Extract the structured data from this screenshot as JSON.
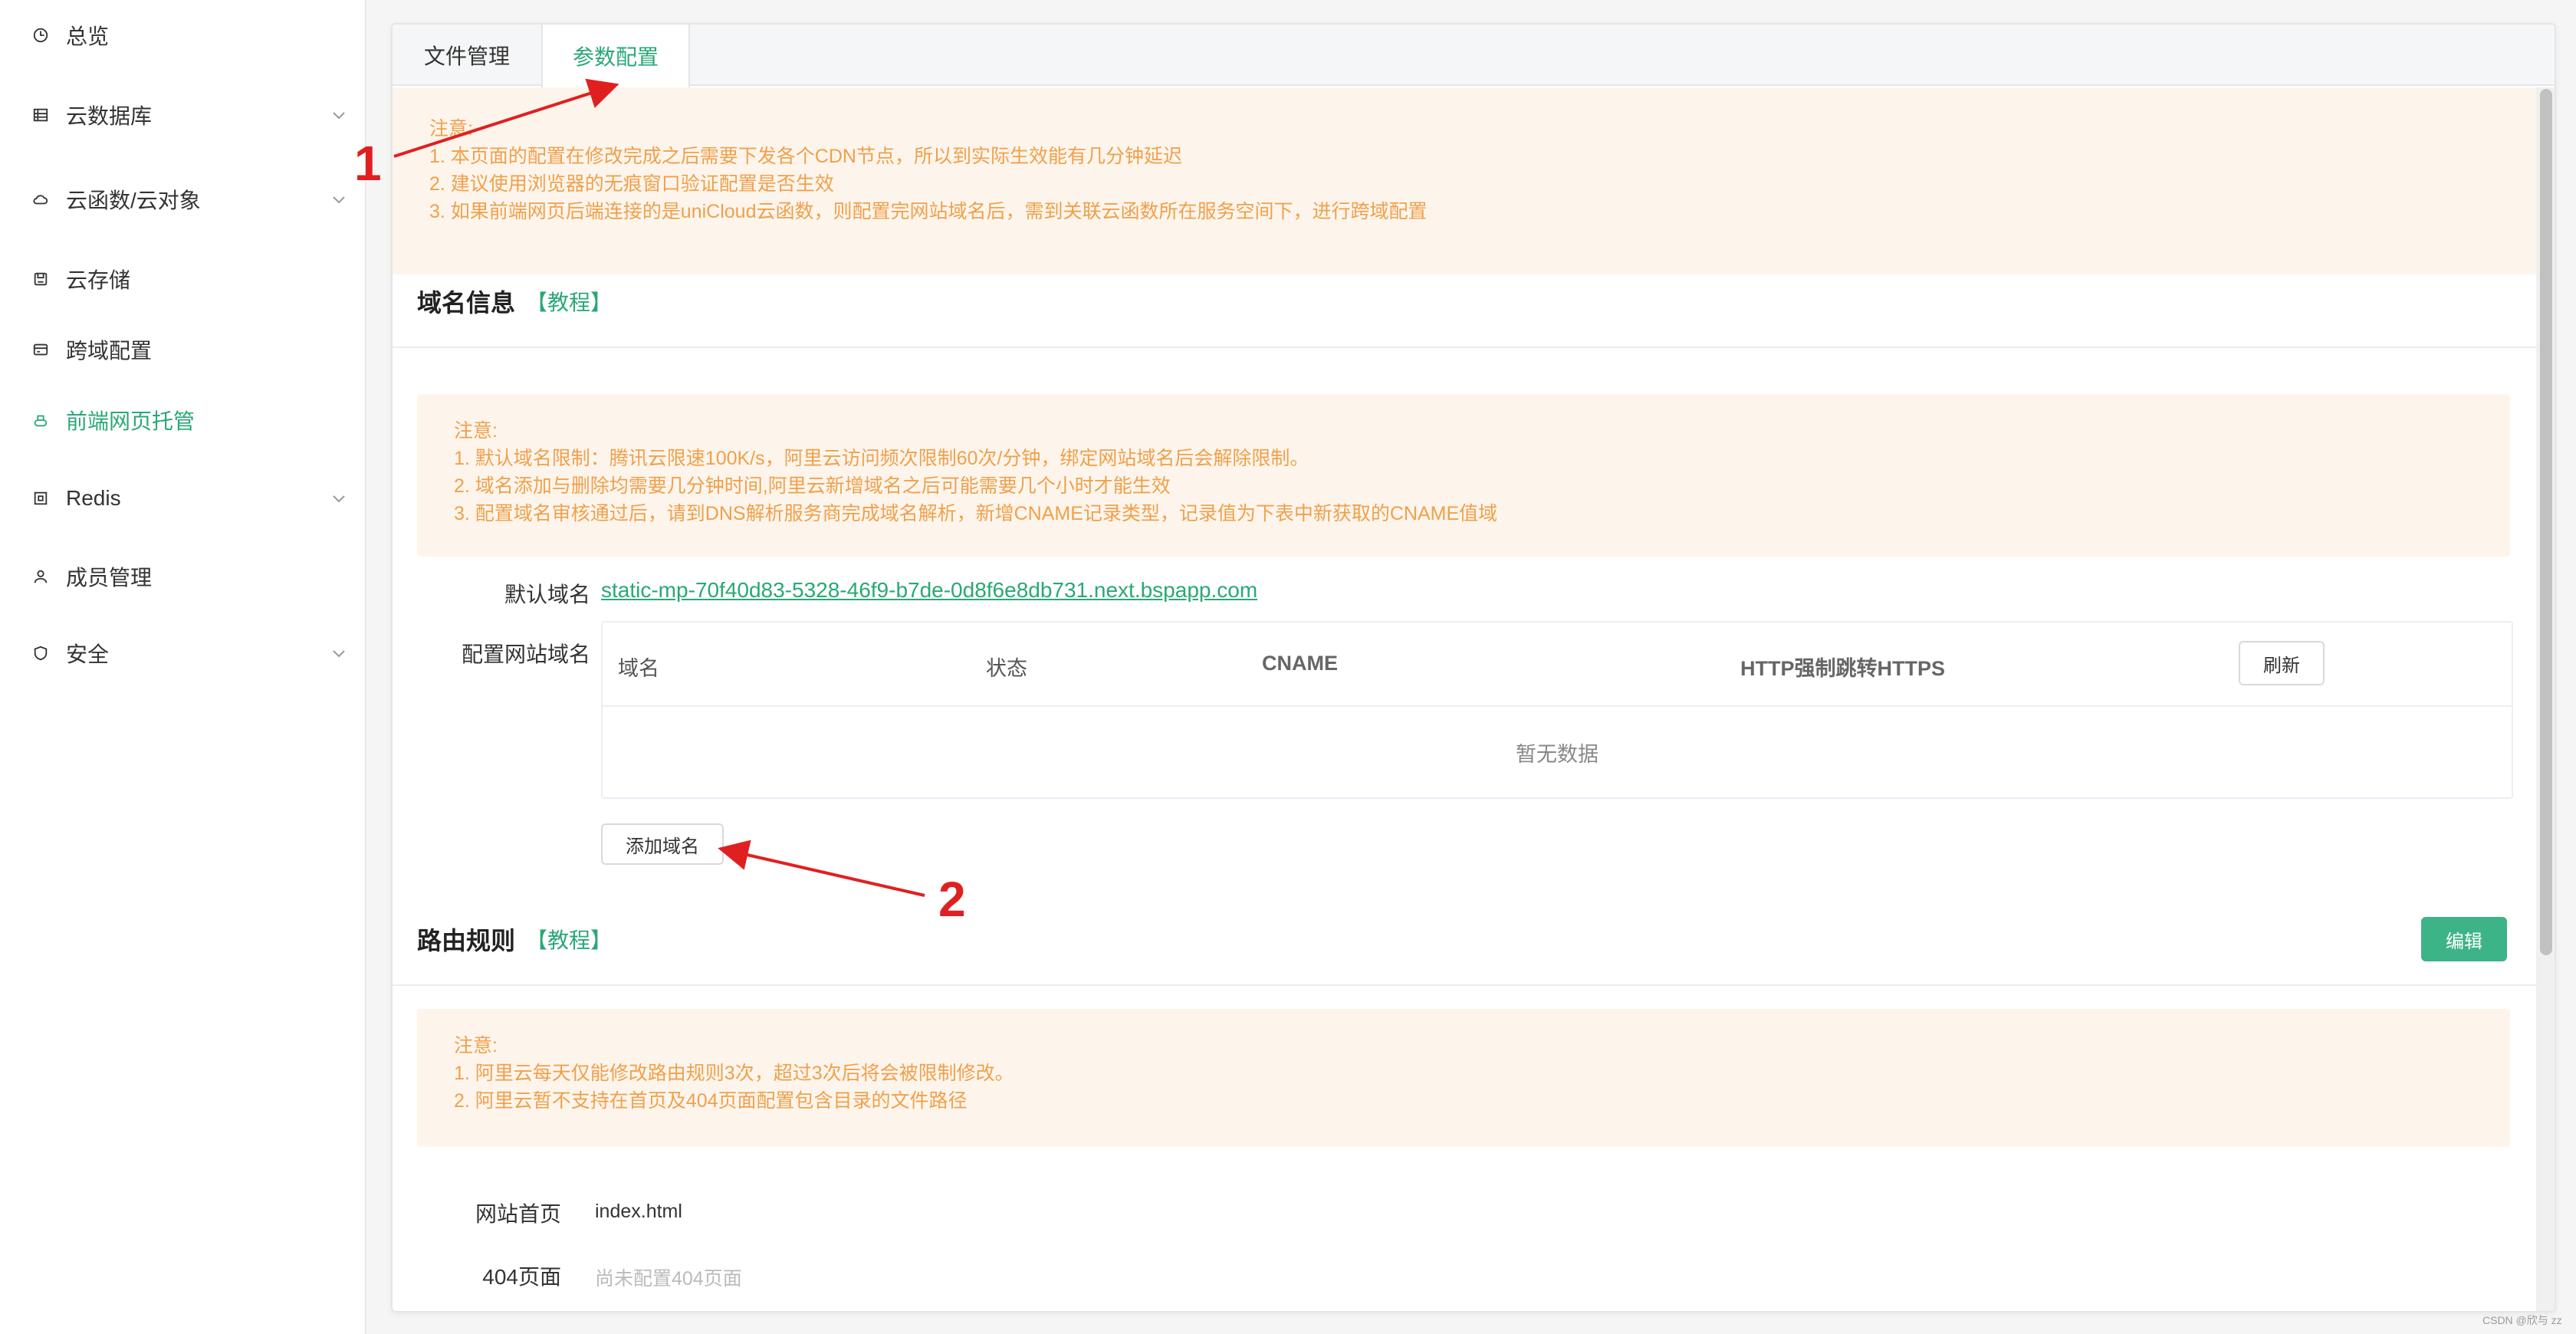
{
  "sidebar": {
    "items": [
      {
        "label": "总览",
        "icon": "clock-icon"
      },
      {
        "label": "云数据库",
        "icon": "database-icon",
        "expandable": true
      },
      {
        "label": "云函数/云对象",
        "icon": "cloud-icon",
        "expandable": true
      },
      {
        "label": "云存储",
        "icon": "storage-icon"
      },
      {
        "label": "跨域配置",
        "icon": "cors-icon"
      },
      {
        "label": "前端网页托管",
        "icon": "hosting-icon",
        "active": true
      },
      {
        "label": "Redis",
        "icon": "redis-icon",
        "expandable": true
      },
      {
        "label": "成员管理",
        "icon": "user-icon"
      },
      {
        "label": "安全",
        "icon": "shield-icon",
        "expandable": true
      }
    ]
  },
  "tabs": [
    {
      "label": "文件管理"
    },
    {
      "label": "参数配置",
      "active": true
    }
  ],
  "top_notice": {
    "title": "注意:",
    "lines": [
      "1. 本页面的配置在修改完成之后需要下发各个CDN节点，所以到实际生效能有几分钟延迟",
      "2. 建议使用浏览器的无痕窗口验证配置是否生效",
      "3. 如果前端网页后端连接的是uniCloud云函数，则配置完网站域名后，需到关联云函数所在服务空间下，进行跨域配置"
    ]
  },
  "domain_section": {
    "title": "域名信息",
    "tutorial": "【教程】",
    "notice_title": "注意:",
    "notice_lines": [
      "1. 默认域名限制：腾讯云限速100K/s，阿里云访问频次限制60次/分钟，绑定网站域名后会解除限制。",
      "2. 域名添加与删除均需要几分钟时间,阿里云新增域名之后可能需要几个小时才能生效",
      "3. 配置域名审核通过后，请到DNS解析服务商完成域名解析，新增CNAME记录类型，记录值为下表中新获取的CNAME值域"
    ],
    "default_domain_label": "默认域名",
    "default_domain": "static-mp-70f40d83-5328-46f9-b7de-0d8f6e8db731.next.bspapp.com",
    "custom_domain_label": "配置网站域名",
    "table": {
      "columns": [
        "域名",
        "状态",
        "CNAME",
        "HTTP强制跳转HTTPS"
      ],
      "refresh_label": "刷新",
      "empty_text": "暂无数据"
    },
    "add_label": "添加域名"
  },
  "route_section": {
    "title": "路由规则",
    "tutorial": "【教程】",
    "edit_label": "编辑",
    "notice_title": "注意:",
    "notice_lines": [
      "1. 阿里云每天仅能修改路由规则3次，超过3次后将会被限制修改。",
      "2. 阿里云暂不支持在首页及404页面配置包含目录的文件路径"
    ],
    "index_label": "网站首页",
    "index_value": "index.html",
    "notfound_label": "404页面",
    "notfound_value": "尚未配置404页面"
  },
  "annotations": {
    "marker1": "1",
    "marker2": "2",
    "color": "#e02020"
  },
  "watermark": "CSDN @欣与 zz",
  "colors": {
    "accent": "#2aa876",
    "notice_bg": "#fdf5ec",
    "notice_text": "#f0a04b",
    "edit_button": "#3db388"
  }
}
